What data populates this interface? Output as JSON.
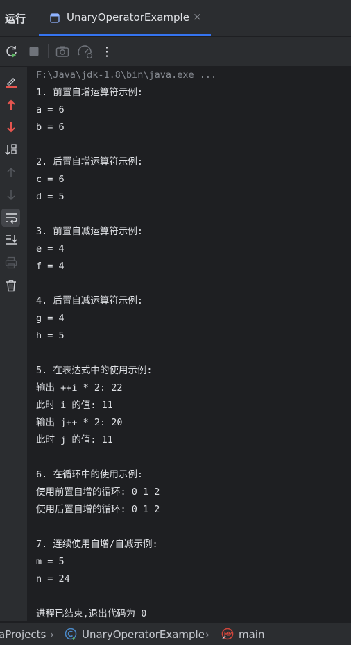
{
  "header": {
    "run_label": "运行",
    "tab_title": "UnaryOperatorExample",
    "tab_close": "×"
  },
  "toolbar": {
    "items": [
      "rerun-icon",
      "stop-icon",
      "screenshot-icon",
      "profiler-icon",
      "more-options-icon"
    ],
    "more": "⋮"
  },
  "sidebar": {
    "items": [
      "clear-all-icon",
      "up-icon",
      "down-icon",
      "sort-icon",
      "scroll-up-icon",
      "scroll-down-icon",
      "soft-wrap-icon",
      "scroll-to-end-icon",
      "print-icon",
      "delete-icon"
    ],
    "active": "soft-wrap-icon"
  },
  "console": {
    "command": "F:\\Java\\jdk-1.8\\bin\\java.exe ...",
    "lines": [
      "1. 前置自增运算符示例:",
      "a = 6",
      "b = 6",
      "",
      "2. 后置自增运算符示例:",
      "c = 6",
      "d = 5",
      "",
      "3. 前置自减运算符示例:",
      "e = 4",
      "f = 4",
      "",
      "4. 后置自减运算符示例:",
      "g = 4",
      "h = 5",
      "",
      "5. 在表达式中的使用示例:",
      "输出 ++i * 2: 22",
      "此时 i 的值: 11",
      "输出 j++ * 2: 20",
      "此时 j 的值: 11",
      "",
      "6. 在循环中的使用示例:",
      "使用前置自增的循环: 0 1 2",
      "使用后置自增的循环: 0 1 2",
      "",
      "7. 连续使用自增/自减示例:",
      "m = 5",
      "n = 24",
      "",
      "进程已结束,退出代码为 0"
    ]
  },
  "status": {
    "crumb_project": "aProjects",
    "sep": "›",
    "crumb_class": "UnaryOperatorExample",
    "crumb_method": "main"
  },
  "colors": {
    "accent": "#3574f0",
    "run_green": "#5fb865",
    "red": "#e5554f"
  }
}
